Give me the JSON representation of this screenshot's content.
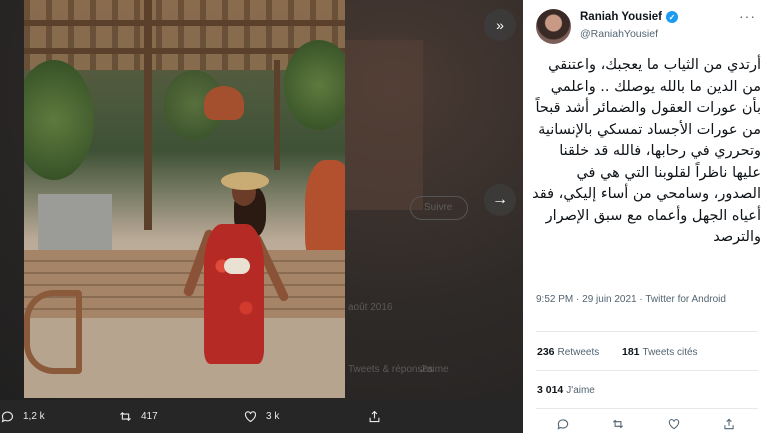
{
  "viewer": {
    "background_text": {
      "line1": "Suivre",
      "line2": "août 2016",
      "line3": "J'aime",
      "line4": "Tweets & réponses"
    },
    "actions": {
      "reply_count": "1,2 k",
      "retweet_count": "417",
      "like_count": "3 k"
    }
  },
  "tweet": {
    "author_name": "Raniah Yousief",
    "author_handle": "@RaniahYousief",
    "text": "أرتدي من الثياب ما يعجبك، واعتنقي من الدين ما بالله يوصلك .. واعلمي بأن عورات العقول والضمائر أشد قبحاً من عورات الأجساد  تمسكي بالإنسانية وتحرري في رحابها، فالله قد خلقنا عليها ناظراً لقلوبنا التي هي في الصدور، وسامحي من أساء إليكي، فقد أعياه الجهل وأعماه مع سبق الإصرار والترصد",
    "time": "9:52 PM · 29 juin 2021",
    "source_prefix": " · ",
    "source": "Twitter for Android",
    "retweets_count": "236",
    "retweets_label": "Retweets",
    "quotes_count": "181",
    "quotes_label": "Tweets cités",
    "likes_count": "3 014",
    "likes_label": "J'aime"
  },
  "colors": {
    "accent": "#1d9bf0",
    "text_primary": "#0f1419",
    "text_secondary": "#536471",
    "viewer_bg": "#262626"
  },
  "icons": [
    "expand-icon",
    "next-arrow-icon",
    "reply-icon",
    "retweet-icon",
    "like-icon",
    "share-icon",
    "verified-icon",
    "more-icon"
  ]
}
